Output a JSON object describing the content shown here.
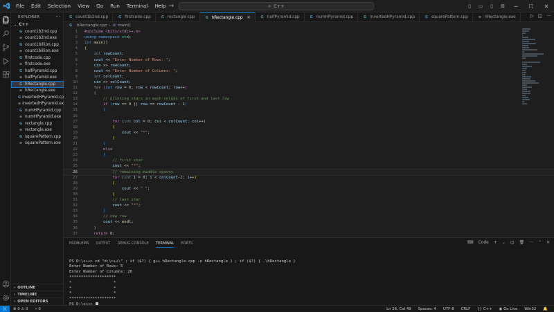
{
  "titlebar": {
    "menus": [
      "File",
      "Edit",
      "Selection",
      "View",
      "Go",
      "Run",
      "Terminal",
      "Help"
    ],
    "search_text": "C++"
  },
  "sidebar": {
    "title": "EXPLORER",
    "folder": "C++",
    "files": [
      {
        "name": "count1b2nd.cpp",
        "type": "cpp"
      },
      {
        "name": "count1b2nd.exe",
        "type": "exe"
      },
      {
        "name": "count1billion.cpp",
        "type": "cpp"
      },
      {
        "name": "count1billion.exe",
        "type": "exe"
      },
      {
        "name": "firstcode.cpp",
        "type": "cpp"
      },
      {
        "name": "firstcode.exe",
        "type": "exe"
      },
      {
        "name": "halfPyramid.cpp",
        "type": "cpp"
      },
      {
        "name": "halfPyramid.exe",
        "type": "exe"
      },
      {
        "name": "hRectangle.cpp",
        "type": "cpp",
        "active": true
      },
      {
        "name": "hRectangle.exe",
        "type": "exe"
      },
      {
        "name": "invertedHPyramid.cpp",
        "type": "cpp"
      },
      {
        "name": "invertedHPyramid.exe",
        "type": "exe"
      },
      {
        "name": "numHPyramid.cpp",
        "type": "cpp"
      },
      {
        "name": "numHPyramid.exe",
        "type": "exe"
      },
      {
        "name": "rectangle.cpp",
        "type": "cpp"
      },
      {
        "name": "rectangle.exe",
        "type": "exe"
      },
      {
        "name": "squarePattern.cpp",
        "type": "cpp"
      },
      {
        "name": "squarePattern.exe",
        "type": "exe"
      }
    ],
    "sections": [
      "OUTLINE",
      "TIMELINE",
      "OPEN EDITORS"
    ]
  },
  "tabs": [
    {
      "name": "count1b2nd.cpp",
      "type": "cpp"
    },
    {
      "name": "firstcode.cpp",
      "type": "cpp"
    },
    {
      "name": "rectangle.cpp",
      "type": "cpp"
    },
    {
      "name": "hRectangle.cpp",
      "type": "cpp",
      "active": true
    },
    {
      "name": "halfPyramid.cpp",
      "type": "cpp"
    },
    {
      "name": "numHPyramid.cpp",
      "type": "cpp"
    },
    {
      "name": "invertedHPyramid.cpp",
      "type": "cpp"
    },
    {
      "name": "squarePattern.cpp",
      "type": "cpp"
    },
    {
      "name": "hRectangle.exe",
      "type": "exe"
    }
  ],
  "breadcrumb": {
    "file": "hRectangle.cpp",
    "symbol": "main()"
  },
  "editor": {
    "current_line": 26,
    "lines": [
      [
        {
          "t": "#include <bits/stdc++.h>",
          "c": "#c586c0"
        }
      ],
      [
        {
          "t": "using namespace ",
          "c": "#569cd6"
        },
        {
          "t": "std",
          "c": "#4ec9b0"
        },
        {
          "t": ";",
          "c": "#d4d4d4"
        }
      ],
      [
        {
          "t": "int ",
          "c": "#569cd6"
        },
        {
          "t": "main",
          "c": "#dcdcaa"
        },
        {
          "t": "()",
          "c": "#d4d4d4"
        }
      ],
      [
        {
          "t": "{",
          "c": "#ffd700"
        }
      ],
      [
        {
          "t": "    int ",
          "c": "#569cd6"
        },
        {
          "t": "rowCount",
          "c": "#9cdcfe"
        },
        {
          "t": ";",
          "c": "#d4d4d4"
        }
      ],
      [
        {
          "t": "    cout ",
          "c": "#9cdcfe"
        },
        {
          "t": "<< ",
          "c": "#d4d4d4"
        },
        {
          "t": "\"Enter Number of Rows: \"",
          "c": "#ce9178"
        },
        {
          "t": ";",
          "c": "#d4d4d4"
        }
      ],
      [
        {
          "t": "    cin ",
          "c": "#9cdcfe"
        },
        {
          "t": ">> ",
          "c": "#d4d4d4"
        },
        {
          "t": "rowCount",
          "c": "#9cdcfe"
        },
        {
          "t": ";",
          "c": "#d4d4d4"
        }
      ],
      [
        {
          "t": "    cout ",
          "c": "#9cdcfe"
        },
        {
          "t": "<< ",
          "c": "#d4d4d4"
        },
        {
          "t": "\"Enter Number of Columns: \"",
          "c": "#ce9178"
        },
        {
          "t": ";",
          "c": "#d4d4d4"
        }
      ],
      [
        {
          "t": "    int ",
          "c": "#569cd6"
        },
        {
          "t": "colCount",
          "c": "#9cdcfe"
        },
        {
          "t": ";",
          "c": "#d4d4d4"
        }
      ],
      [
        {
          "t": "    cin ",
          "c": "#9cdcfe"
        },
        {
          "t": ">> ",
          "c": "#d4d4d4"
        },
        {
          "t": "colCount",
          "c": "#9cdcfe"
        },
        {
          "t": ";",
          "c": "#d4d4d4"
        }
      ],
      [
        {
          "t": "    for ",
          "c": "#c586c0"
        },
        {
          "t": "(",
          "c": "#da70d6"
        },
        {
          "t": "int ",
          "c": "#569cd6"
        },
        {
          "t": "row ",
          "c": "#9cdcfe"
        },
        {
          "t": "= ",
          "c": "#d4d4d4"
        },
        {
          "t": "0",
          "c": "#b5cea8"
        },
        {
          "t": "; ",
          "c": "#d4d4d4"
        },
        {
          "t": "row ",
          "c": "#9cdcfe"
        },
        {
          "t": "< ",
          "c": "#d4d4d4"
        },
        {
          "t": "rowCount",
          "c": "#9cdcfe"
        },
        {
          "t": "; ",
          "c": "#d4d4d4"
        },
        {
          "t": "row",
          "c": "#9cdcfe"
        },
        {
          "t": "++",
          "c": "#d4d4d4"
        },
        {
          "t": ")",
          "c": "#da70d6"
        }
      ],
      [
        {
          "t": "    {",
          "c": "#da70d6"
        }
      ],
      [
        {
          "t": "        // printing stars in each column of first and last row",
          "c": "#6a9955"
        }
      ],
      [
        {
          "t": "        if ",
          "c": "#c586c0"
        },
        {
          "t": "(",
          "c": "#179fff"
        },
        {
          "t": "row ",
          "c": "#9cdcfe"
        },
        {
          "t": "== ",
          "c": "#d4d4d4"
        },
        {
          "t": "0 ",
          "c": "#b5cea8"
        },
        {
          "t": "|| ",
          "c": "#d4d4d4"
        },
        {
          "t": "row ",
          "c": "#9cdcfe"
        },
        {
          "t": "== ",
          "c": "#d4d4d4"
        },
        {
          "t": "rowCount ",
          "c": "#9cdcfe"
        },
        {
          "t": "- ",
          "c": "#d4d4d4"
        },
        {
          "t": "1",
          "c": "#b5cea8"
        },
        {
          "t": ")",
          "c": "#179fff"
        }
      ],
      [
        {
          "t": "        {",
          "c": "#179fff"
        }
      ],
      [
        {
          "t": "",
          "c": "#d4d4d4"
        }
      ],
      [
        {
          "t": "            for ",
          "c": "#c586c0"
        },
        {
          "t": "(",
          "c": "#ffd700"
        },
        {
          "t": "int ",
          "c": "#569cd6"
        },
        {
          "t": "col ",
          "c": "#9cdcfe"
        },
        {
          "t": "= ",
          "c": "#d4d4d4"
        },
        {
          "t": "0",
          "c": "#b5cea8"
        },
        {
          "t": "; ",
          "c": "#d4d4d4"
        },
        {
          "t": "col ",
          "c": "#9cdcfe"
        },
        {
          "t": "< ",
          "c": "#d4d4d4"
        },
        {
          "t": "colCount",
          "c": "#9cdcfe"
        },
        {
          "t": "; ",
          "c": "#d4d4d4"
        },
        {
          "t": "col",
          "c": "#9cdcfe"
        },
        {
          "t": "++",
          "c": "#d4d4d4"
        },
        {
          "t": ")",
          "c": "#ffd700"
        }
      ],
      [
        {
          "t": "            {",
          "c": "#ffd700"
        }
      ],
      [
        {
          "t": "                cout ",
          "c": "#9cdcfe"
        },
        {
          "t": "<< ",
          "c": "#d4d4d4"
        },
        {
          "t": "\"*\"",
          "c": "#ce9178"
        },
        {
          "t": ";",
          "c": "#d4d4d4"
        }
      ],
      [
        {
          "t": "            }",
          "c": "#ffd700"
        }
      ],
      [
        {
          "t": "        }",
          "c": "#179fff"
        }
      ],
      [
        {
          "t": "        else",
          "c": "#c586c0"
        }
      ],
      [
        {
          "t": "        {",
          "c": "#179fff"
        }
      ],
      [
        {
          "t": "            // first star",
          "c": "#6a9955"
        }
      ],
      [
        {
          "t": "            cout ",
          "c": "#9cdcfe"
        },
        {
          "t": "<< ",
          "c": "#d4d4d4"
        },
        {
          "t": "\"*\"",
          "c": "#ce9178"
        },
        {
          "t": ";",
          "c": "#d4d4d4"
        }
      ],
      [
        {
          "t": "            // remaining middle spaces",
          "c": "#6a9955"
        }
      ],
      [
        {
          "t": "            for ",
          "c": "#c586c0"
        },
        {
          "t": "(",
          "c": "#ffd700"
        },
        {
          "t": "int ",
          "c": "#569cd6"
        },
        {
          "t": "i ",
          "c": "#9cdcfe"
        },
        {
          "t": "= ",
          "c": "#d4d4d4"
        },
        {
          "t": "0",
          "c": "#b5cea8"
        },
        {
          "t": "; ",
          "c": "#d4d4d4"
        },
        {
          "t": "i ",
          "c": "#9cdcfe"
        },
        {
          "t": "< ",
          "c": "#d4d4d4"
        },
        {
          "t": "colCount",
          "c": "#9cdcfe"
        },
        {
          "t": "-",
          "c": "#d4d4d4"
        },
        {
          "t": "2",
          "c": "#b5cea8"
        },
        {
          "t": "; ",
          "c": "#d4d4d4"
        },
        {
          "t": "i",
          "c": "#9cdcfe"
        },
        {
          "t": "++",
          "c": "#d4d4d4"
        },
        {
          "t": ")",
          "c": "#ffd700"
        }
      ],
      [
        {
          "t": "            {",
          "c": "#ffd700"
        }
      ],
      [
        {
          "t": "                cout ",
          "c": "#9cdcfe"
        },
        {
          "t": "<< ",
          "c": "#d4d4d4"
        },
        {
          "t": "\" \"",
          "c": "#ce9178"
        },
        {
          "t": ";",
          "c": "#d4d4d4"
        }
      ],
      [
        {
          "t": "            }",
          "c": "#ffd700"
        }
      ],
      [
        {
          "t": "            // last star",
          "c": "#6a9955"
        }
      ],
      [
        {
          "t": "            cout ",
          "c": "#9cdcfe"
        },
        {
          "t": "<< ",
          "c": "#d4d4d4"
        },
        {
          "t": "\"*\"",
          "c": "#ce9178"
        },
        {
          "t": ";",
          "c": "#d4d4d4"
        }
      ],
      [
        {
          "t": "        }",
          "c": "#179fff"
        }
      ],
      [
        {
          "t": "        // new row",
          "c": "#6a9955"
        }
      ],
      [
        {
          "t": "        cout ",
          "c": "#9cdcfe"
        },
        {
          "t": "<< ",
          "c": "#d4d4d4"
        },
        {
          "t": "endl",
          "c": "#dcdcaa"
        },
        {
          "t": ";",
          "c": "#d4d4d4"
        }
      ],
      [
        {
          "t": "    }",
          "c": "#da70d6"
        }
      ],
      [
        {
          "t": "    return ",
          "c": "#c586c0"
        },
        {
          "t": "0",
          "c": "#b5cea8"
        },
        {
          "t": ";",
          "c": "#d4d4d4"
        }
      ]
    ]
  },
  "panel": {
    "tabs": [
      "PROBLEMS",
      "OUTPUT",
      "DEBUG CONSOLE",
      "TERMINAL",
      "PORTS"
    ],
    "active_tab": "TERMINAL",
    "terminal_profile": "Code",
    "terminal_lines": [
      "",
      "PS D:\\c++> cd \"d:\\c++\\\" ; if ($?) { g++ hRectangle.cpp -o hRectangle } ; if ($?) { .\\hRectangle }",
      "Enter Number of Rows: 5",
      "Enter Number of Columns: 20",
      "********************",
      "*                  *",
      "*                  *",
      "*                  *",
      "********************",
      "PS D:\\c++> "
    ]
  },
  "statusbar": {
    "errors": "0",
    "warnings": "0",
    "ports": "0",
    "position": "Ln 26, Col 49",
    "spaces": "Spaces: 4",
    "encoding": "UTF-8",
    "eol": "CRLF",
    "language": "C++",
    "golive": "Go Live",
    "platform": "Win32"
  }
}
